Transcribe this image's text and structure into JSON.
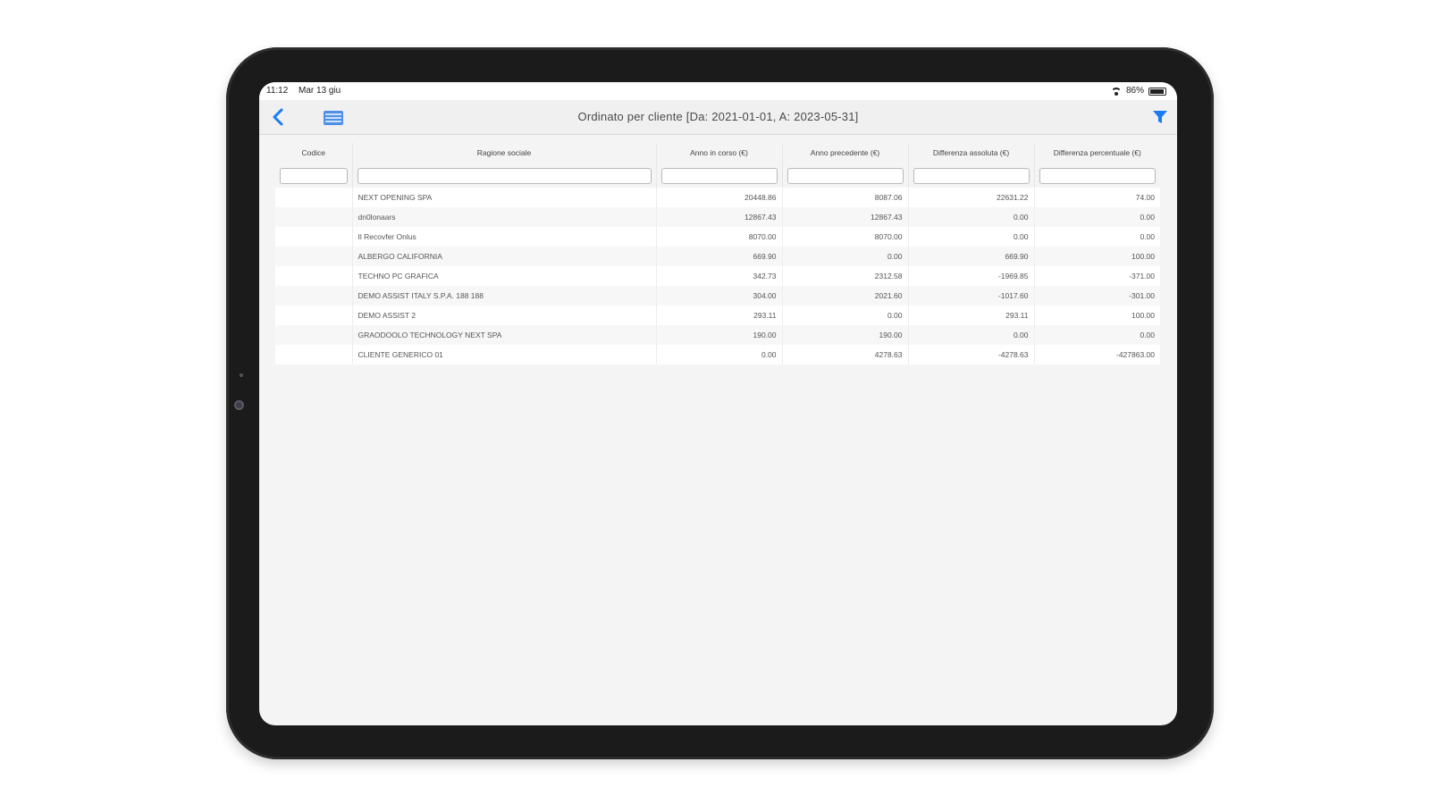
{
  "status_bar": {
    "time": "11:12",
    "date": "Mar 13 giu",
    "battery": "86%"
  },
  "nav": {
    "title": "Ordinato per cliente [Da: 2021-01-01, A: 2023-05-31]"
  },
  "colors": {
    "accent": "#1a7cf5",
    "screen_bg": "#f4f4f4",
    "frame": "#1b1b1b"
  },
  "icons": {
    "back": "chevron-left-icon",
    "list": "list-icon",
    "filter": "filter-icon",
    "wifi": "wifi-icon",
    "battery": "battery-icon"
  },
  "table": {
    "columns": [
      "Codice",
      "Ragione sociale",
      "Anno in corso (€)",
      "Anno precedente (€)",
      "Differenza assoluta (€)",
      "Differenza percentuale (€)"
    ],
    "rows": [
      [
        "",
        "NEXT OPENING SPA",
        "20448.86",
        "8087.06",
        "22631.22",
        "74.00"
      ],
      [
        "",
        "dn0lonaars",
        "12867.43",
        "12867.43",
        "0.00",
        "0.00"
      ],
      [
        "",
        "Il Recovfer Onlus",
        "8070.00",
        "8070.00",
        "0.00",
        "0.00"
      ],
      [
        "",
        "ALBERGO CALIFORNIA",
        "669.90",
        "0.00",
        "669.90",
        "100.00"
      ],
      [
        "",
        "TECHNO PC GRAFICA",
        "342.73",
        "2312.58",
        "-1969.85",
        "-371.00"
      ],
      [
        "",
        "DEMO ASSIST ITALY S.P.A. 188 188",
        "304.00",
        "2021.60",
        "-1017.60",
        "-301.00"
      ],
      [
        "",
        "DEMO ASSIST 2",
        "293.11",
        "0.00",
        "293.11",
        "100.00"
      ],
      [
        "",
        "GRAODOOLO TECHNOLOGY NEXT SPA",
        "190.00",
        "190.00",
        "0.00",
        "0.00"
      ],
      [
        "",
        "CLIENTE GENERICO 01",
        "0.00",
        "4278.63",
        "-4278.63",
        "-427863.00"
      ]
    ]
  }
}
